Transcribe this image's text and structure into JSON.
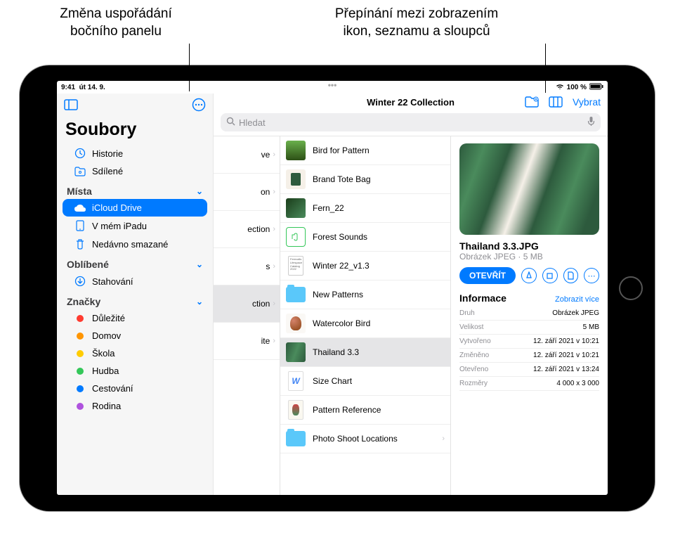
{
  "callouts": {
    "left": "Změna uspořádání\nbočního panelu",
    "right": "Přepínání mezi zobrazením\nikon, seznamu a sloupců"
  },
  "statusbar": {
    "time": "9:41",
    "date": "út 14. 9.",
    "wifi": "100 %"
  },
  "sidebar": {
    "title": "Soubory",
    "history": "Historie",
    "shared": "Sdílené",
    "sections": {
      "places": "Místa",
      "favorites": "Oblíbené",
      "tags": "Značky"
    },
    "places": {
      "icloud": "iCloud Drive",
      "ipad": "V mém iPadu",
      "trash": "Nedávno smazané"
    },
    "favorites": {
      "downloads": "Stahování"
    },
    "tags": [
      {
        "label": "Důležité",
        "color": "#ff3b30"
      },
      {
        "label": "Domov",
        "color": "#ff9500"
      },
      {
        "label": "Škola",
        "color": "#ffcc00"
      },
      {
        "label": "Hudba",
        "color": "#34c759"
      },
      {
        "label": "Cestování",
        "color": "#007aff"
      },
      {
        "label": "Rodina",
        "color": "#af52de"
      }
    ]
  },
  "toolbar": {
    "title": "Winter 22 Collection",
    "select": "Vybrat"
  },
  "search": {
    "placeholder": "Hledat"
  },
  "col1": [
    "ve",
    "on",
    "ection",
    "s",
    "ction",
    "ite"
  ],
  "col2": [
    {
      "name": "Bird for Pattern",
      "thumb": "img-leaf"
    },
    {
      "name": "Brand Tote Bag",
      "thumb": "img-bag"
    },
    {
      "name": "Fern_22",
      "thumb": "img-fern"
    },
    {
      "name": "Forest Sounds",
      "thumb": "audio"
    },
    {
      "name": "Winter 22_v1.3",
      "thumb": "doc"
    },
    {
      "name": "New Patterns",
      "thumb": "folder"
    },
    {
      "name": "Watercolor Bird",
      "thumb": "img-bird"
    },
    {
      "name": "Thailand 3.3",
      "thumb": "img-palm",
      "selected": true
    },
    {
      "name": "Size Chart",
      "thumb": "file-w"
    },
    {
      "name": "Pattern Reference",
      "thumb": "img-flower"
    },
    {
      "name": "Photo Shoot Locations",
      "thumb": "folder",
      "chev": true
    }
  ],
  "preview": {
    "name": "Thailand 3.3.JPG",
    "meta": "Obrázek JPEG · 5 MB",
    "open": "OTEVŘÍT",
    "info_label": "Informace",
    "show_more": "Zobrazit více",
    "rows": [
      {
        "k": "Druh",
        "v": "Obrázek JPEG"
      },
      {
        "k": "Velikost",
        "v": "5 MB"
      },
      {
        "k": "Vytvořeno",
        "v": "12. září 2021 v 10:21"
      },
      {
        "k": "Změněno",
        "v": "12. září 2021 v 10:21"
      },
      {
        "k": "Otevřeno",
        "v": "12. září 2021 v 13:24"
      },
      {
        "k": "Rozměry",
        "v": "4 000 x 3 000"
      }
    ]
  }
}
